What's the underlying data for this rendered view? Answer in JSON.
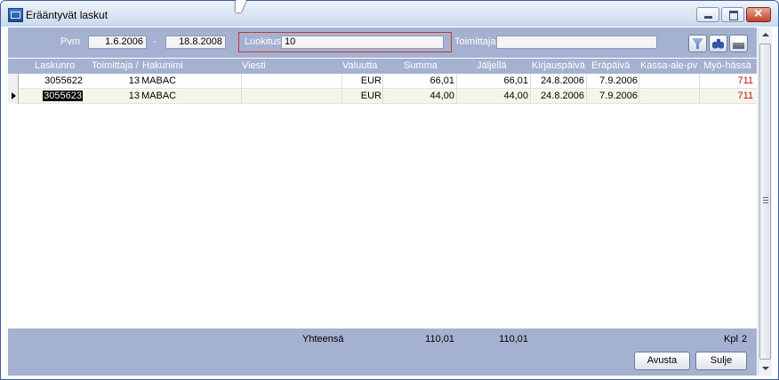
{
  "window": {
    "title": "Erääntyvät laskut"
  },
  "filters": {
    "pvm_label": "Pvm",
    "date_from": "1.6.2006",
    "separator": "-",
    "date_to": "18.8.2008",
    "luokitus_label": "Luokitus",
    "luokitus_value": "10",
    "toimittaja_label": "Toimittaja",
    "toimittaja_value": ""
  },
  "toolbar": {
    "icons": [
      "funnel-icon",
      "binoculars-icon",
      "printer-icon"
    ]
  },
  "columns": [
    {
      "key": "laskunro",
      "label": "Laskunro"
    },
    {
      "key": "toimittaja",
      "label": "Toimittaja /"
    },
    {
      "key": "hakunimi",
      "label": "Hakunimi"
    },
    {
      "key": "viesti",
      "label": "Viesti"
    },
    {
      "key": "valuutta",
      "label": "Valuutta"
    },
    {
      "key": "summa",
      "label": "Summa"
    },
    {
      "key": "jaljella",
      "label": "Jäljellä"
    },
    {
      "key": "kirjauspaiva",
      "label": "Kirjauspäivä"
    },
    {
      "key": "erapaiva",
      "label": "Eräpäivä"
    },
    {
      "key": "kassa_ale_pv",
      "label": "Kassa-ale-pv"
    },
    {
      "key": "myohassa",
      "label": "Myö-hässä"
    }
  ],
  "rows": [
    {
      "laskunro": "3055622",
      "toimittaja": "13",
      "hakunimi": "MABAC",
      "viesti": "",
      "valuutta": "EUR",
      "summa": "66,01",
      "jaljella": "66,01",
      "kirjauspaiva": "24.8.2006",
      "erapaiva": "7.9.2006",
      "kassa_ale_pv": "",
      "myohassa": "711"
    },
    {
      "laskunro": "3055623",
      "toimittaja": "13",
      "hakunimi": "MABAC",
      "viesti": "",
      "valuutta": "EUR",
      "summa": "44,00",
      "jaljella": "44,00",
      "kirjauspaiva": "24.8.2006",
      "erapaiva": "7.9.2006",
      "kassa_ale_pv": "",
      "myohassa": "711"
    }
  ],
  "footer": {
    "total_label": "Yhteensä",
    "total_summa": "110,01",
    "total_jaljella": "110,01",
    "count_label": "Kpl",
    "count_value": "2",
    "help_button": "Avusta",
    "close_button": "Sulje"
  },
  "colors": {
    "panel": "#a5b1d1",
    "alt_row": "#f7f5e9",
    "late_value": "#c01010",
    "highlight_box": "#c0392b"
  }
}
